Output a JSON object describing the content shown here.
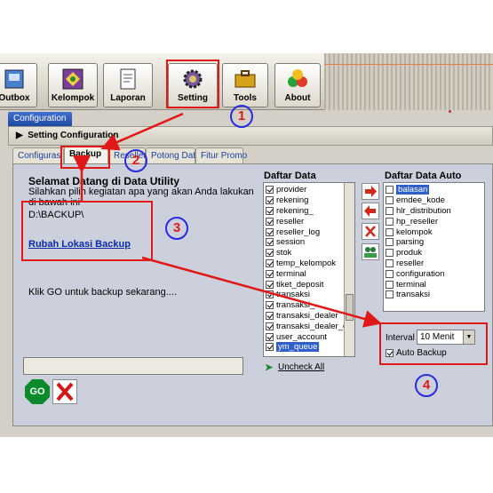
{
  "toolbar": {
    "buttons": [
      {
        "label": "Outbox",
        "icon": "outbox-icon"
      },
      {
        "label": "Kelompok",
        "icon": "group-icon"
      },
      {
        "label": "Laporan",
        "icon": "report-icon"
      },
      {
        "label": "Setting",
        "icon": "settings-icon"
      },
      {
        "label": "Tools",
        "icon": "tools-icon"
      },
      {
        "label": "About",
        "icon": "about-icon"
      }
    ]
  },
  "window": {
    "title_tab": "Configuration",
    "section_header": "Setting Configuration"
  },
  "tabs": [
    "Configurasi",
    "Backup",
    "Reseller",
    "Potong Data",
    "Fitur Promo"
  ],
  "backup_panel": {
    "welcome_title": "Selamat Datang di Data Utility",
    "welcome_text": "Silahkan pilih kegiatan apa yang akan Anda lakukan di bawah ini",
    "path": "D:\\BACKUP\\",
    "change_link": "Rubah Lokasi Backup",
    "go_instruction": "Klik GO untuk backup sekarang....",
    "go_label": "GO"
  },
  "daftar_data": {
    "title": "Daftar Data",
    "items": [
      {
        "label": "provider",
        "checked": true
      },
      {
        "label": "rekening",
        "checked": true
      },
      {
        "label": "rekening_",
        "checked": true
      },
      {
        "label": "reseller",
        "checked": true
      },
      {
        "label": "reseller_log",
        "checked": true
      },
      {
        "label": "session",
        "checked": true
      },
      {
        "label": "stok",
        "checked": true
      },
      {
        "label": "temp_kelompok",
        "checked": true
      },
      {
        "label": "terminal",
        "checked": true
      },
      {
        "label": "tiket_deposit",
        "checked": true
      },
      {
        "label": "transaksi",
        "checked": true
      },
      {
        "label": "transaksi_",
        "checked": true
      },
      {
        "label": "transaksi_dealer",
        "checked": true
      },
      {
        "label": "transaksi_dealer_de",
        "checked": true
      },
      {
        "label": "user_account",
        "checked": true
      },
      {
        "label": "ym_queue",
        "checked": true,
        "selected": true
      }
    ],
    "uncheck_all": "Uncheck All"
  },
  "auto_backup_list": {
    "title": "Daftar Data Auto Backup",
    "items": [
      {
        "label": "balasan",
        "checked": false,
        "selected": true
      },
      {
        "label": "emdee_kode",
        "checked": false
      },
      {
        "label": "hlr_distribution",
        "checked": false
      },
      {
        "label": "hp_reseller",
        "checked": false
      },
      {
        "label": "kelompok",
        "checked": false
      },
      {
        "label": "parsing",
        "checked": false
      },
      {
        "label": "produk",
        "checked": false
      },
      {
        "label": "reseller",
        "checked": false
      },
      {
        "label": "configuration",
        "checked": false
      },
      {
        "label": "terminal",
        "checked": false
      },
      {
        "label": "transaksi",
        "checked": false
      }
    ]
  },
  "auto_backup": {
    "interval_label": "Interval :",
    "interval_value": "10 Menit",
    "checkbox_label": "Auto Backup",
    "checked": true
  },
  "annotations": [
    "1",
    "2",
    "3",
    "4"
  ],
  "colors": {
    "annotation_red": "#e01818",
    "annotation_blue": "#2a2ae0",
    "selection": "#2f5fc8"
  }
}
